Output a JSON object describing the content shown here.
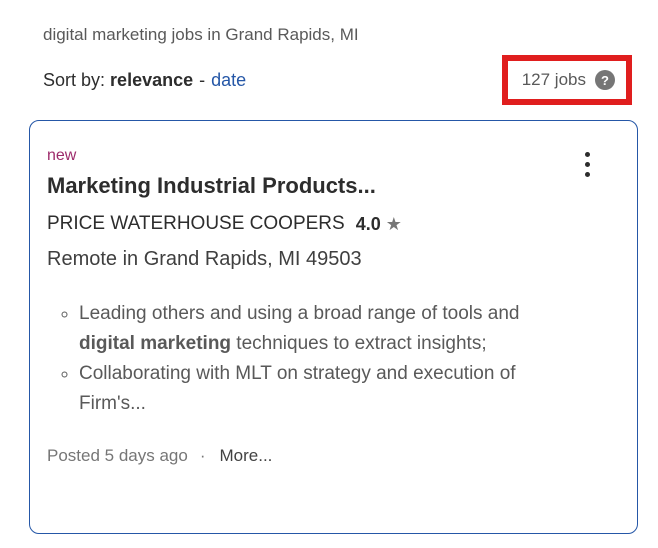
{
  "colors": {
    "card_border_blue": "#2557a7",
    "link_blue": "#2557a7",
    "new_badge_magenta": "#9d2b6b",
    "annotation_red": "#e01e1e",
    "text_dark": "#2d2d2d",
    "text_gray": "#595959",
    "text_light_gray": "#767676"
  },
  "header": {
    "query": "digital marketing jobs in Grand Rapids, MI",
    "sort": {
      "label": "Sort by:",
      "active": "relevance",
      "separator": "-",
      "alternative": "date"
    },
    "job_count": {
      "text": "127 jobs",
      "help_glyph": "?"
    }
  },
  "card": {
    "badge_new": "new",
    "title": "Marketing Industrial Products...",
    "company": "PRICE WATERHOUSE COOPERS",
    "rating": "4.0",
    "rating_star": "★",
    "location": "Remote in Grand Rapids, MI 49503",
    "bullets": [
      {
        "prefix": "Leading others and using a broad range of tools and ",
        "bold": "digital marketing",
        "suffix": " techniques to extract insights;"
      },
      {
        "prefix": "Collaborating with MLT on strategy and execution of Firm's...",
        "bold": "",
        "suffix": ""
      }
    ],
    "footer": {
      "posted": "Posted 5 days ago",
      "separator": "·",
      "more": "More..."
    }
  }
}
